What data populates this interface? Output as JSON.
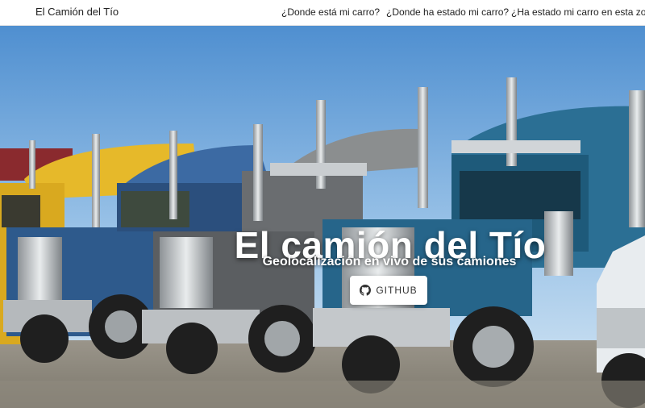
{
  "navbar": {
    "brand": "El Camión del Tío",
    "links": [
      {
        "label": "¿Donde está mi carro?"
      },
      {
        "label": "¿Donde ha estado mi carro?"
      },
      {
        "label": "¿Ha estado mi carro en esta zona?"
      }
    ]
  },
  "hero": {
    "title": "El camión del Tío",
    "subtitle": "Geolocalización en vivo de sus camiones",
    "button": {
      "label": "GITHUB",
      "icon": "github-icon"
    }
  },
  "colors": {
    "sky_top": "#5d9bd8",
    "sky_bottom": "#cfe3f4",
    "truck_blue": "#2e5a8c",
    "truck_gray": "#6a6d70",
    "truck_teal": "#1e5a7a",
    "truck_yellow": "#e6b92a",
    "ground": "#8a8577"
  }
}
